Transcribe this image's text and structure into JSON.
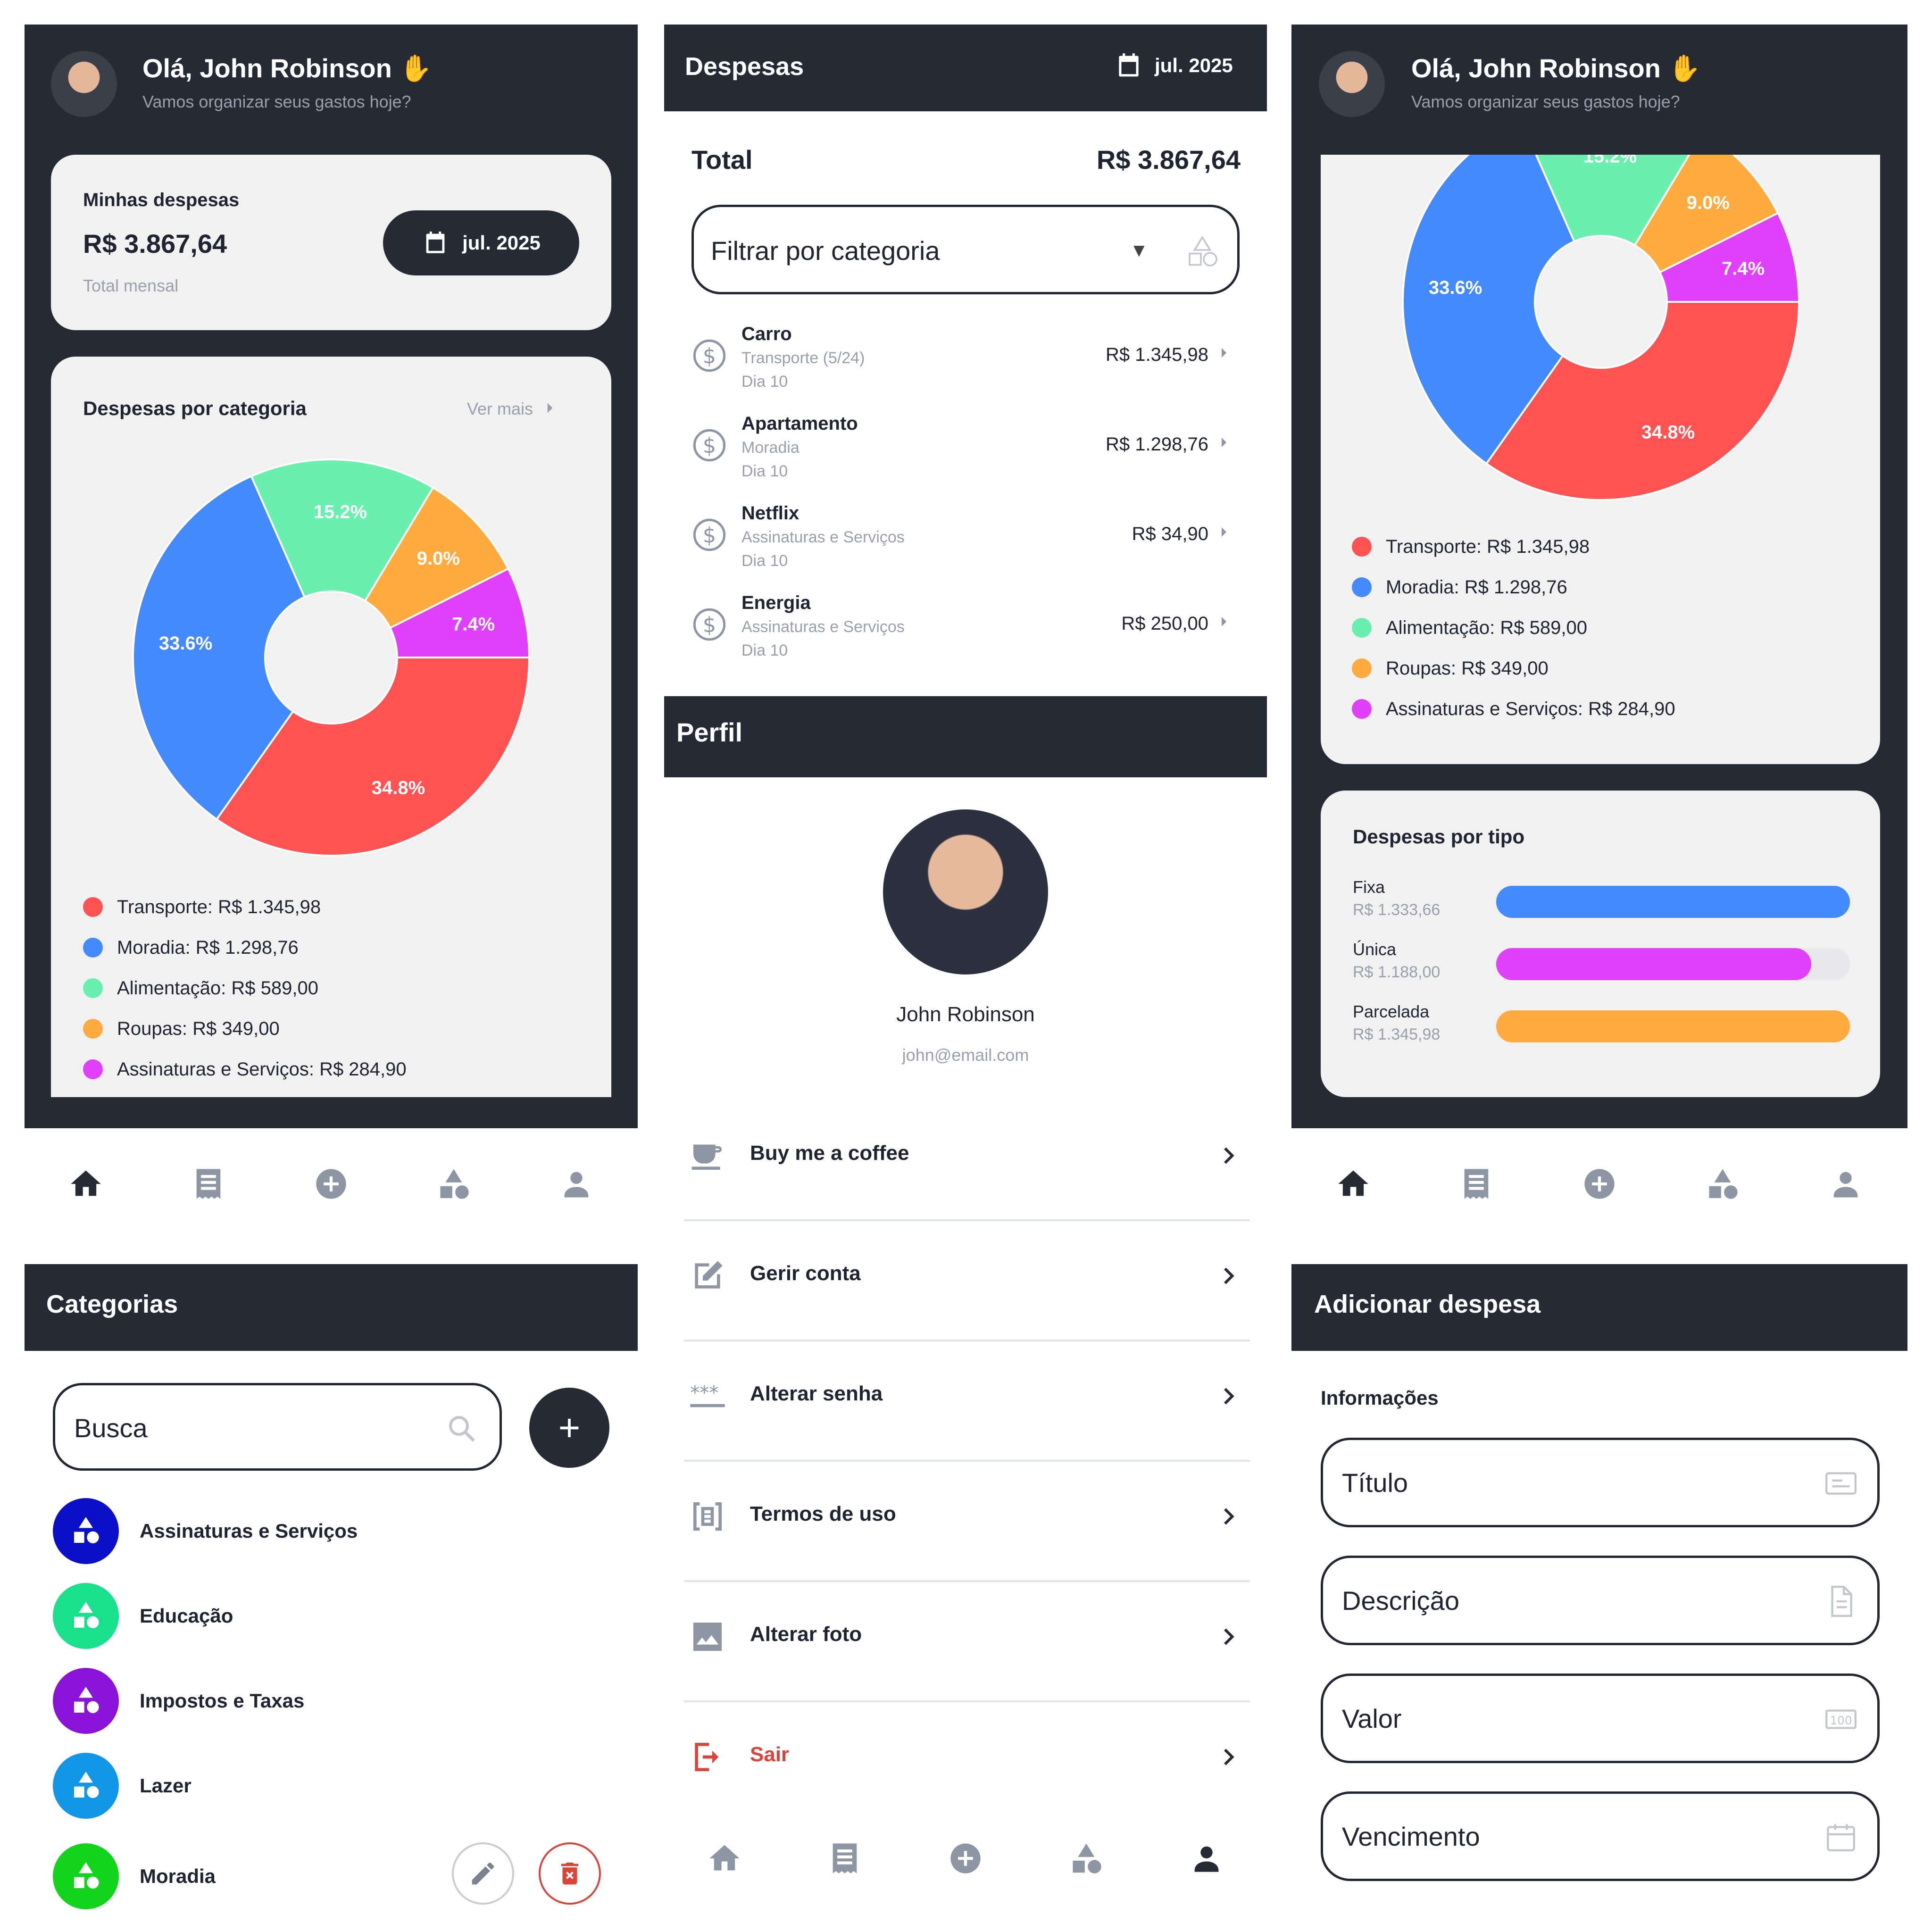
{
  "home": {
    "greeting": "Olá, John Robinson",
    "subtitle": "Vamos organizar seus gastos hoje?",
    "summary_title": "Minhas despesas",
    "summary_value": "R$ 3.867,64",
    "summary_caption": "Total mensal",
    "month_button": "jul. 2025",
    "category_title": "Despesas por categoria",
    "see_more": "Ver mais"
  },
  "chart_data": {
    "type": "pie",
    "categories": [
      "Transporte",
      "Moradia",
      "Alimentação",
      "Roupas",
      "Assinaturas e Serviços"
    ],
    "values": [
      34.8,
      33.6,
      15.2,
      9.0,
      7.4
    ],
    "labels": [
      "34.8%",
      "33.6%",
      "15.2%",
      "9.0%",
      "7.4%"
    ],
    "colors": [
      "#ff5252",
      "#448aff",
      "#69f0ae",
      "#ffab40",
      "#e040fb"
    ],
    "legend": [
      "Transporte: R$ 1.345,98",
      "Moradia: R$ 1.298,76",
      "Alimentação: R$ 589,00",
      "Roupas: R$ 349,00",
      "Assinaturas e Serviços: R$ 284,90"
    ],
    "title": "Despesas por categoria",
    "donut": true
  },
  "by_type": {
    "title": "Despesas por tipo",
    "items": [
      {
        "label": "Fixa",
        "value": "R$ 1.333,66",
        "fraction": 1.0,
        "color": "#448aff"
      },
      {
        "label": "Única",
        "value": "R$ 1.188,00",
        "fraction": 0.89,
        "color": "#e040fb"
      },
      {
        "label": "Parcelada",
        "value": "R$ 1.345,98",
        "fraction": 1.0,
        "color": "#ffab40"
      }
    ]
  },
  "expenses": {
    "title": "Despesas",
    "month": "jul. 2025",
    "total_label": "Total",
    "total_value": "R$ 3.867,64",
    "filter_placeholder": "Filtrar por categoria",
    "items": [
      {
        "name": "Carro",
        "category": "Transporte (5/24)",
        "day": "Dia 10",
        "amount": "R$ 1.345,98"
      },
      {
        "name": "Apartamento",
        "category": "Moradia",
        "day": "Dia 10",
        "amount": "R$ 1.298,76"
      },
      {
        "name": "Netflix",
        "category": "Assinaturas e Serviços",
        "day": "Dia 10",
        "amount": "R$ 34,90"
      },
      {
        "name": "Energia",
        "category": "Assinaturas e Serviços",
        "day": "Dia 10",
        "amount": "R$ 250,00"
      }
    ]
  },
  "profile": {
    "title": "Perfil",
    "name": "John Robinson",
    "email": "john@email.com",
    "menu": [
      {
        "label": "Buy me a coffee",
        "icon": "coffee-icon"
      },
      {
        "label": "Gerir conta",
        "icon": "edit-icon"
      },
      {
        "label": "Alterar senha",
        "icon": "password-icon"
      },
      {
        "label": "Termos de uso",
        "icon": "document-icon"
      },
      {
        "label": "Alterar foto",
        "icon": "image-icon"
      },
      {
        "label": "Sair",
        "icon": "logout-icon"
      }
    ]
  },
  "categories": {
    "title": "Categorias",
    "search_placeholder": "Busca",
    "items": [
      {
        "name": "Assinaturas e Serviços",
        "color": "#0a10c8"
      },
      {
        "name": "Educação",
        "color": "#19e08d"
      },
      {
        "name": "Impostos e Taxas",
        "color": "#8a13d8"
      },
      {
        "name": "Lazer",
        "color": "#1296e8"
      },
      {
        "name": "Moradia",
        "color": "#12d41a"
      }
    ]
  },
  "add_expense": {
    "title": "Adicionar despesa",
    "section": "Informações",
    "fields": [
      {
        "label": "Título",
        "icon": "title-field-icon"
      },
      {
        "label": "Descrição",
        "icon": "description-field-icon"
      },
      {
        "label": "Valor",
        "icon": "money-field-icon"
      },
      {
        "label": "Vencimento",
        "icon": "calendar-field-icon"
      }
    ]
  },
  "nav": [
    "home-icon",
    "receipt-icon",
    "add-circle-icon",
    "categories-icon",
    "person-icon"
  ]
}
